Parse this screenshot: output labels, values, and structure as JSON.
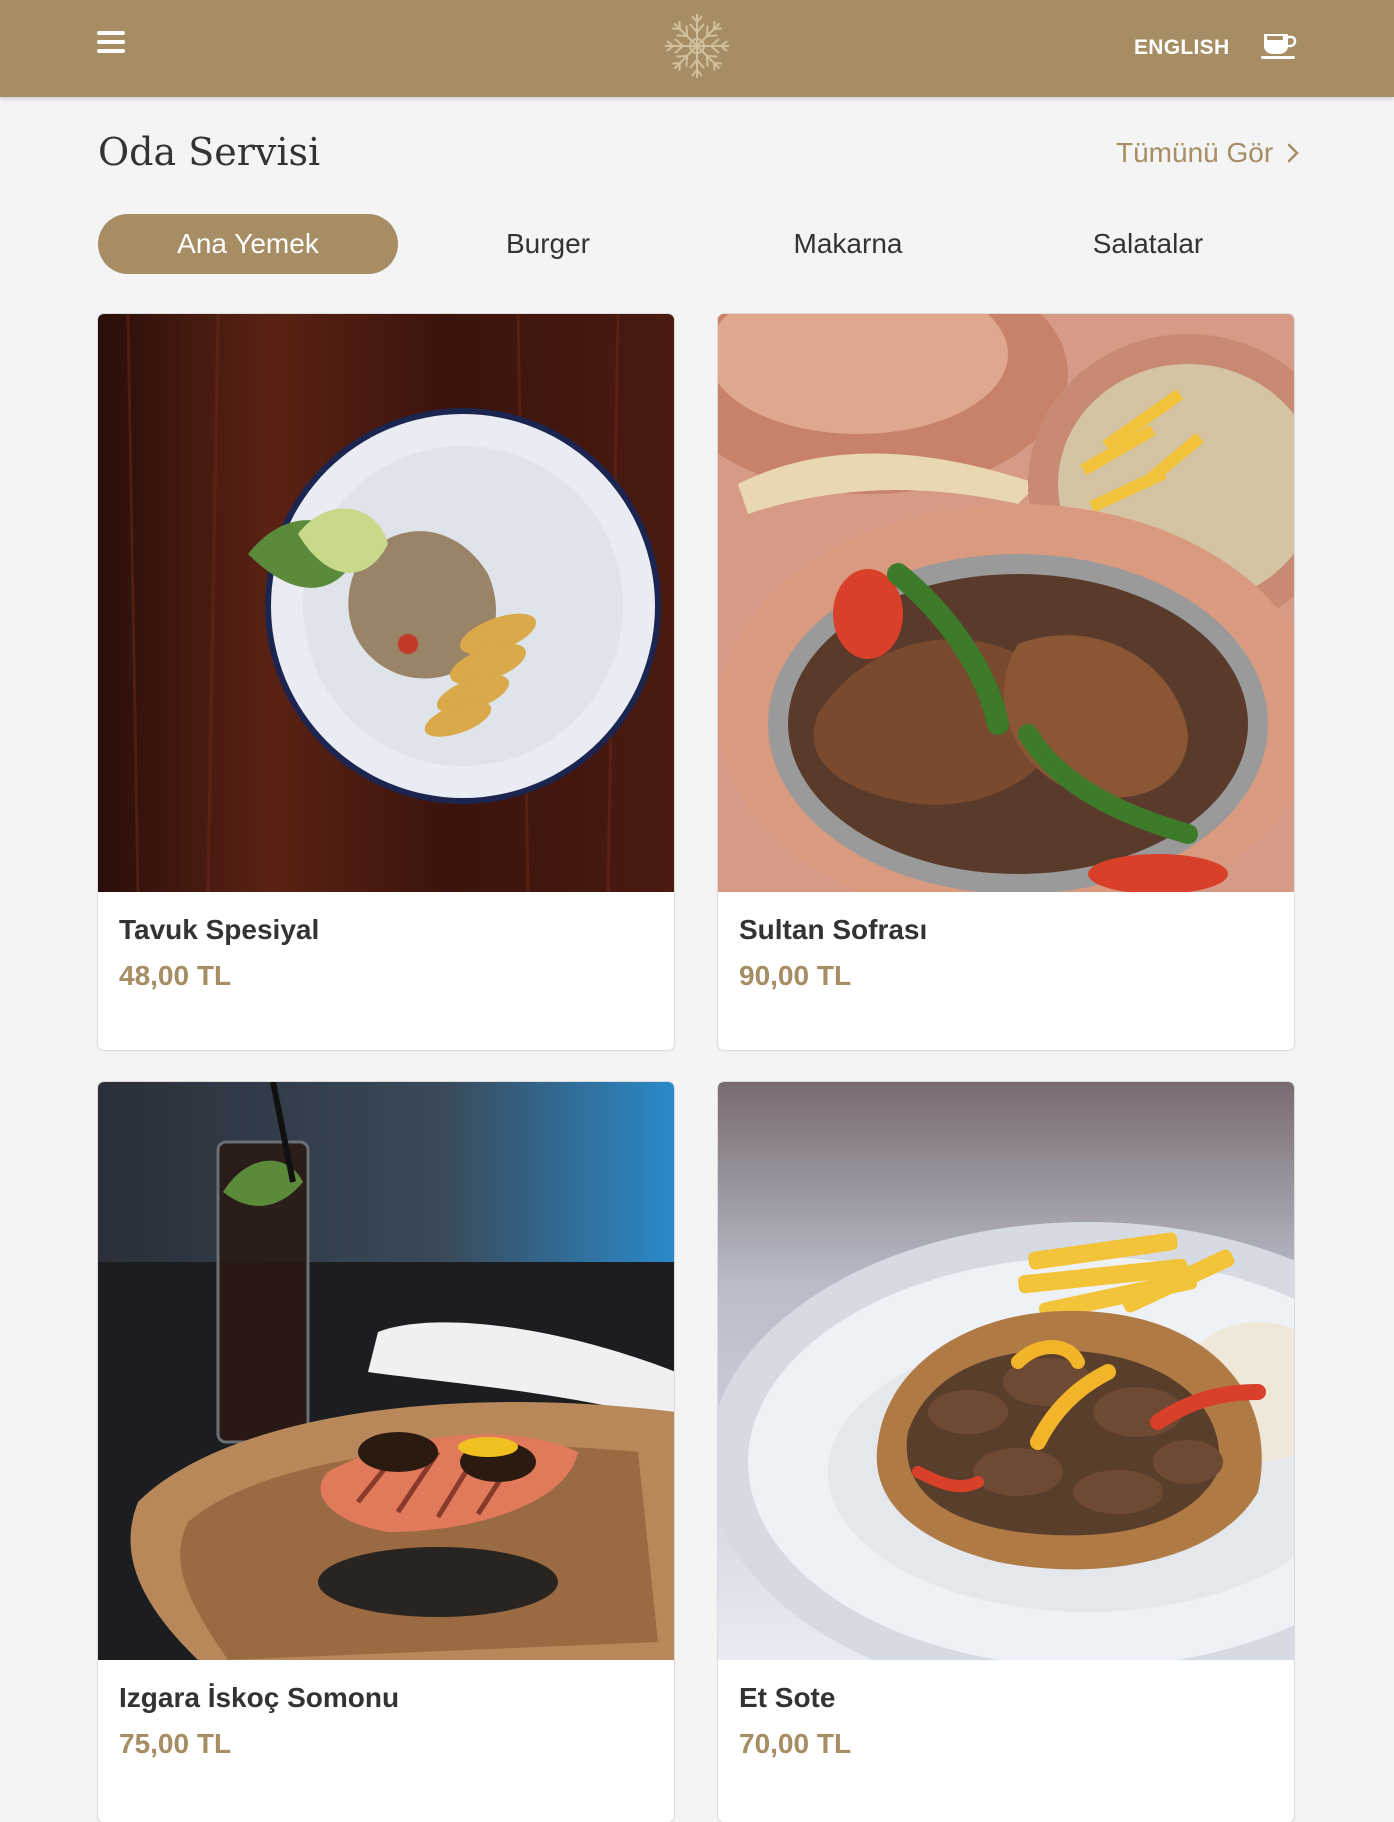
{
  "header": {
    "language_label": "ENGLISH",
    "menu_icon": "hamburger-menu-icon",
    "logo_icon": "snowflake-logo-icon",
    "room_service_icon": "coffee-cup-icon",
    "brand_color": "#a68d63"
  },
  "page": {
    "title": "Oda Servisi",
    "see_all_label": "Tümünü Gör"
  },
  "tabs": [
    {
      "label": "Ana Yemek",
      "active": true
    },
    {
      "label": "Burger",
      "active": false
    },
    {
      "label": "Makarna",
      "active": false
    },
    {
      "label": "Salatalar",
      "active": false
    }
  ],
  "products": [
    {
      "name": "Tavuk Spesiyal",
      "price": "48,00 TL"
    },
    {
      "name": "Sultan Sofrası",
      "price": "90,00 TL"
    },
    {
      "name": "Izgara İskoç Somonu",
      "price": "75,00 TL"
    },
    {
      "name": "Et Sote",
      "price": "70,00 TL"
    }
  ]
}
